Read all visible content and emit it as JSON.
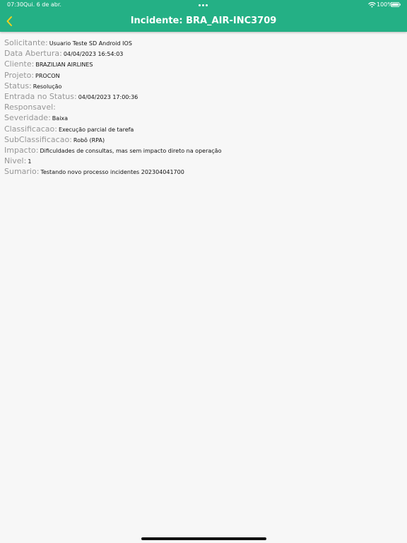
{
  "status_bar": {
    "time": "07:30",
    "date": "Qui. 6 de abr.",
    "battery": "100%"
  },
  "header": {
    "title": "Incidente: BRA_AIR-INC3709",
    "back_icon": "chevron-left-icon"
  },
  "colors": {
    "header_bg": "#24b085",
    "back_icon": "#f2d21b",
    "label": "#979797",
    "value": "#111111"
  },
  "details": [
    {
      "label": "Solicitante:",
      "value": "Usuario Teste SD Android IOS"
    },
    {
      "label": "Data Abertura:",
      "value": "04/04/2023 16:54:03"
    },
    {
      "label": "Cliente:",
      "value": "BRAZILIAN AIRLINES"
    },
    {
      "label": "Projeto:",
      "value": "PROCON"
    },
    {
      "label": "Status:",
      "value": "Resolução"
    },
    {
      "label": "Entrada no Status:",
      "value": "04/04/2023 17:00:36"
    },
    {
      "label": "Responsavel:",
      "value": ""
    },
    {
      "label": "Severidade:",
      "value": "Baixa"
    },
    {
      "label": "Classificacao:",
      "value": "Execução parcial de tarefa"
    },
    {
      "label": "SubClassificacao:",
      "value": "Robô (RPA)"
    },
    {
      "label": "Impacto:",
      "value": "Dificuldades de consultas, mas sem impacto direto na operação"
    },
    {
      "label": "Nivel:",
      "value": "1"
    },
    {
      "label": "Sumario:",
      "value": "Testando novo processo incidentes 202304041700"
    }
  ]
}
